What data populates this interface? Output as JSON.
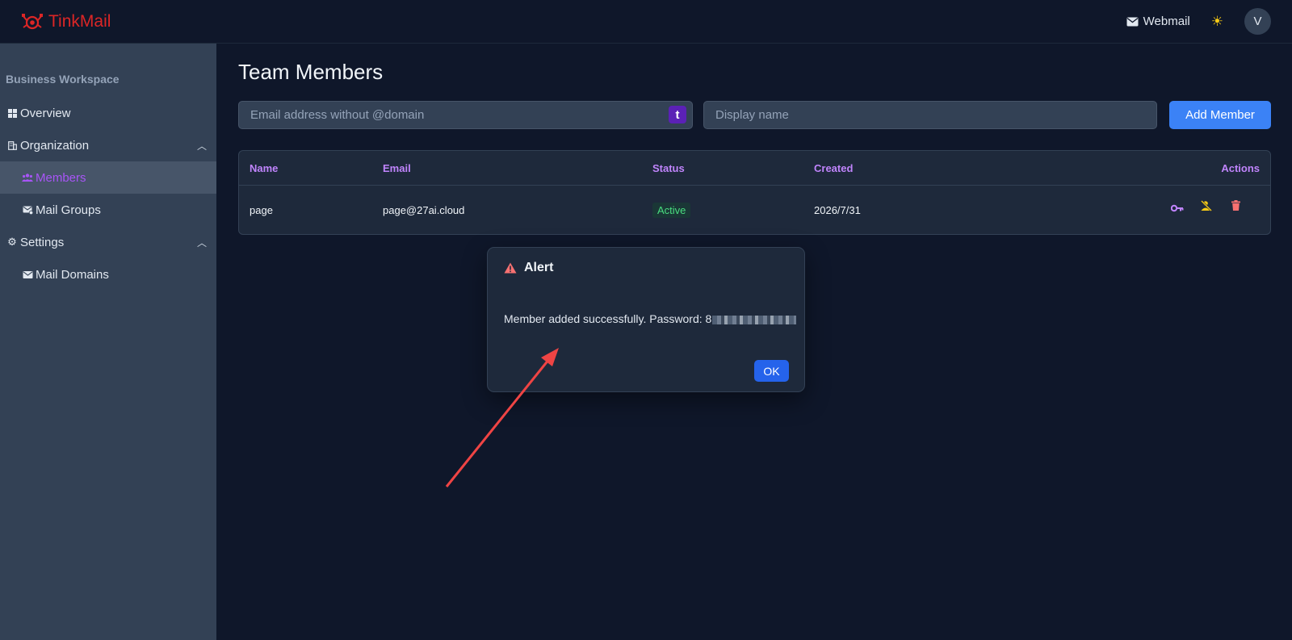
{
  "topbar": {
    "brand": "TinkMail",
    "webmail_label": "Webmail",
    "avatar_letter": "V"
  },
  "sidebar": {
    "workspace_title": "Business Workspace",
    "items": [
      {
        "label": "Overview",
        "icon": "grid-icon"
      },
      {
        "label": "Organization",
        "icon": "building-icon",
        "expanded": true
      },
      {
        "label": "Members",
        "icon": "users-icon",
        "active": true
      },
      {
        "label": "Mail Groups",
        "icon": "mail-group-icon"
      },
      {
        "label": "Settings",
        "icon": "gear-icon",
        "expanded": true
      },
      {
        "label": "Mail Domains",
        "icon": "mail-domain-icon"
      }
    ]
  },
  "main": {
    "title": "Team Members",
    "email_placeholder": "Email address without @domain",
    "domain_badge": "t",
    "name_placeholder": "Display name",
    "add_button": "Add Member",
    "table": {
      "headers": [
        "Name",
        "Email",
        "Status",
        "Created",
        "Actions"
      ],
      "rows": [
        {
          "name": "page",
          "email": "page@27ai.cloud",
          "status": "Active",
          "created": "2026/7/31"
        }
      ]
    }
  },
  "alert": {
    "title": "Alert",
    "message": "Member added successfully. Password: 8",
    "ok_label": "OK"
  },
  "colors": {
    "background": "#0f172a",
    "sidebar": "#334155",
    "accent_purple": "#a855f7",
    "primary_blue": "#3b82f6",
    "brand_red": "#dc2626",
    "status_green": "#4ade80",
    "arrow_red": "#ef4444"
  }
}
